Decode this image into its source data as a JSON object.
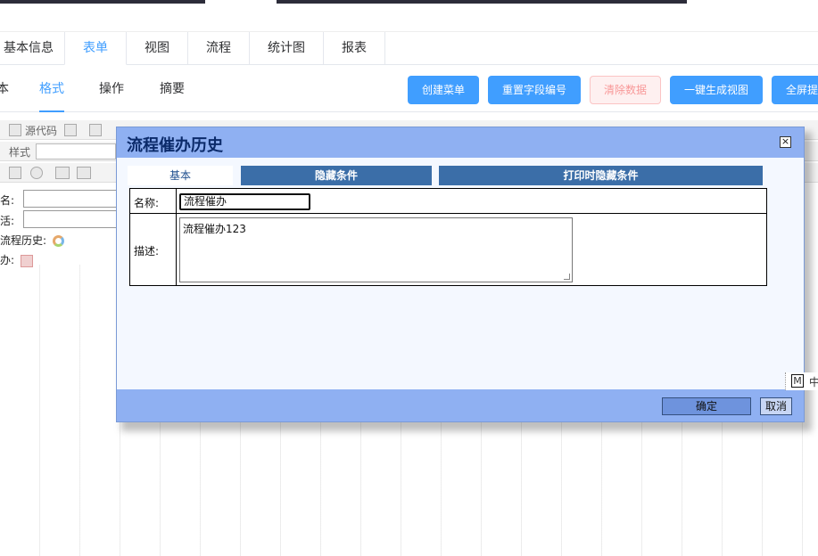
{
  "top_tabs": [
    {
      "label": "基本信息"
    },
    {
      "label": "表单",
      "active": true
    },
    {
      "label": "视图"
    },
    {
      "label": "流程"
    },
    {
      "label": "统计图"
    },
    {
      "label": "报表"
    }
  ],
  "sub_tabs": [
    {
      "label": "本"
    },
    {
      "label": "格式",
      "active": true
    },
    {
      "label": "操作"
    },
    {
      "label": "摘要"
    }
  ],
  "action_buttons": {
    "create_menu": "创建菜单",
    "reset_field_number": "重置字段编号",
    "clear_data": "清除数据",
    "generate_view": "一键生成视图",
    "fullscreen": "全屏提"
  },
  "editor": {
    "source_code": "源代码",
    "style_label": "样式",
    "form_labels": [
      "名:",
      "活:",
      "流程历史:",
      "办:"
    ]
  },
  "dialog": {
    "title": "流程催办历史",
    "tabs": [
      "基本",
      "隐藏条件",
      "打印时隐藏条件"
    ],
    "name_label": "名称:",
    "name_value": "流程催办",
    "desc_label": "描述:",
    "desc_value": "流程催办123",
    "ok_label": "确定",
    "cancel_label": "取消",
    "close_glyph": "×"
  },
  "ime": {
    "mode": "M",
    "lang": "中"
  },
  "colors": {
    "accent": "#409eff",
    "dialog_header": "#8fb0f2",
    "dialog_tab": "#3b6ea8"
  }
}
